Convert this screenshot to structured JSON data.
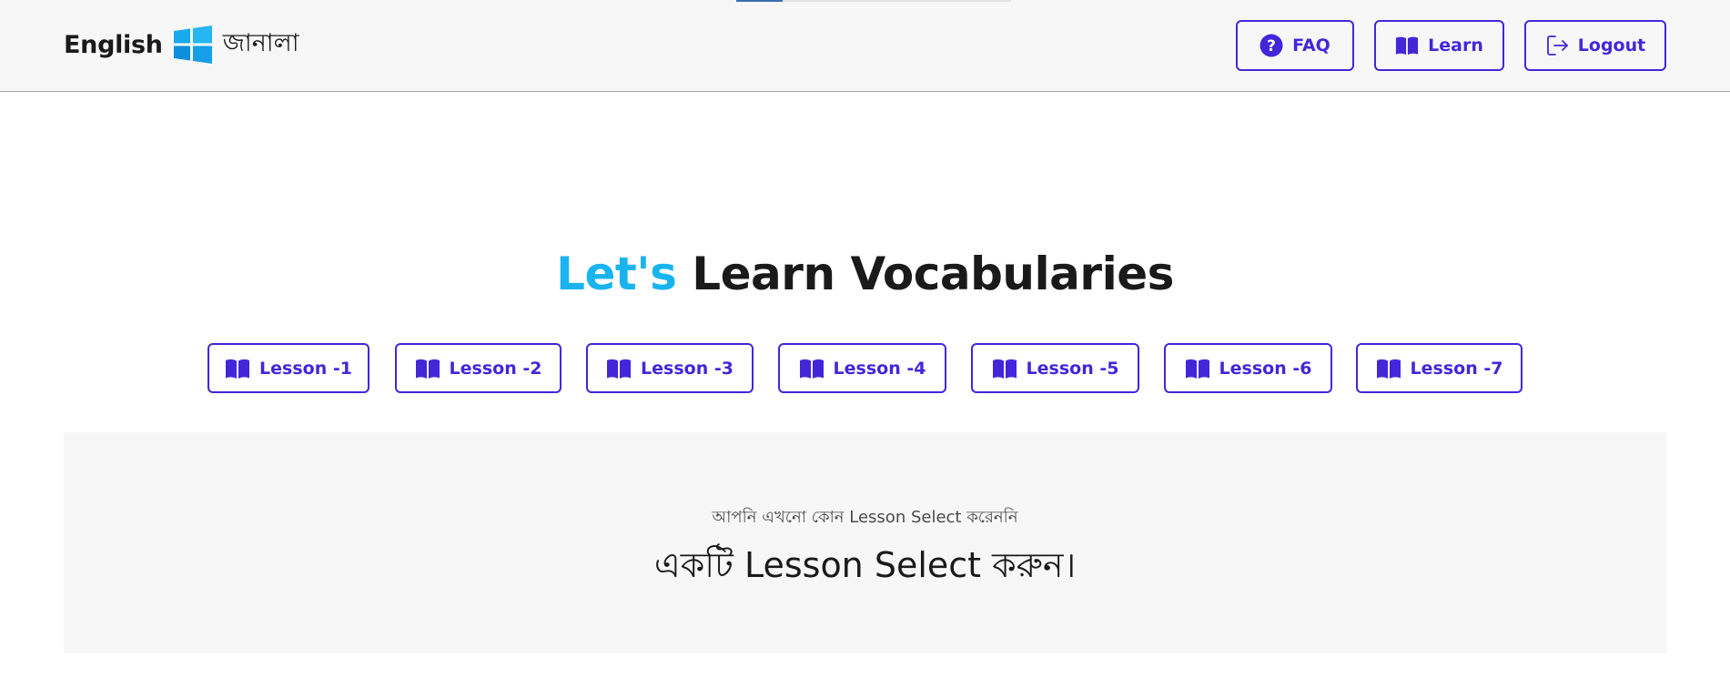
{
  "header": {
    "brand_text": "English",
    "brand_bn": "জানালা",
    "progress_fraction": 0.17,
    "nav": {
      "faq_label": "FAQ",
      "learn_label": "Learn",
      "logout_label": "Logout"
    }
  },
  "main": {
    "heading_accent": "Let's",
    "heading_rest": "Learn Vocabularies",
    "lessons": [
      {
        "label": "Lesson -1"
      },
      {
        "label": "Lesson -2"
      },
      {
        "label": "Lesson -3"
      },
      {
        "label": "Lesson -4"
      },
      {
        "label": "Lesson -5"
      },
      {
        "label": "Lesson -6"
      },
      {
        "label": "Lesson -7"
      }
    ],
    "empty_state": {
      "subtitle": "আপনি এখনো কোন Lesson Select করেননি",
      "title": "একটি Lesson Select করুন।"
    }
  },
  "icons": {
    "faq": "question-circle-icon",
    "learn": "open-book-icon",
    "logout": "logout-arrow-icon",
    "lesson": "open-book-icon",
    "brand": "windows-logo-icon"
  },
  "colors": {
    "accent": "#4426d9",
    "heading_accent": "#19b4ef",
    "header_bg": "#f7f7f7",
    "panel_bg": "#f7f7f7",
    "text": "#1a1a1a"
  }
}
